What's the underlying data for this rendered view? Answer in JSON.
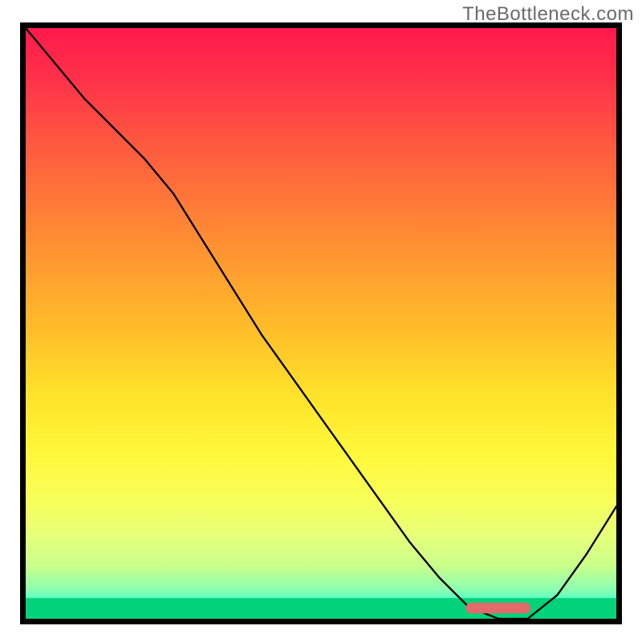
{
  "watermark": "TheBottleneck.com",
  "chart_data": {
    "type": "line",
    "title": "",
    "xlabel": "",
    "ylabel": "",
    "xlim": [
      0,
      1
    ],
    "ylim": [
      0,
      1
    ],
    "x": [
      0.0,
      0.05,
      0.1,
      0.15,
      0.2,
      0.25,
      0.3,
      0.35,
      0.4,
      0.45,
      0.5,
      0.55,
      0.6,
      0.65,
      0.7,
      0.75,
      0.8,
      0.85,
      0.9,
      0.95,
      1.0
    ],
    "y": [
      1.0,
      0.94,
      0.88,
      0.83,
      0.78,
      0.72,
      0.64,
      0.56,
      0.48,
      0.41,
      0.34,
      0.27,
      0.2,
      0.13,
      0.07,
      0.02,
      0.0,
      0.0,
      0.04,
      0.11,
      0.19
    ],
    "flat_segment": {
      "x0": 0.745,
      "x1": 0.855,
      "y": 0.018
    },
    "gradient_stops": [
      {
        "offset": 0.0,
        "color": "#ff1a4b"
      },
      {
        "offset": 0.08,
        "color": "#ff2f4a"
      },
      {
        "offset": 0.2,
        "color": "#ff5a3f"
      },
      {
        "offset": 0.35,
        "color": "#ff8b33"
      },
      {
        "offset": 0.5,
        "color": "#ffba2a"
      },
      {
        "offset": 0.62,
        "color": "#ffe22a"
      },
      {
        "offset": 0.72,
        "color": "#fff83a"
      },
      {
        "offset": 0.8,
        "color": "#f7ff5a"
      },
      {
        "offset": 0.86,
        "color": "#e6ff7a"
      },
      {
        "offset": 0.91,
        "color": "#c9ff8a"
      },
      {
        "offset": 0.95,
        "color": "#8dffb0"
      },
      {
        "offset": 0.975,
        "color": "#3effc8"
      },
      {
        "offset": 1.0,
        "color": "#00e07a"
      }
    ],
    "green_band": {
      "y0": 0.965,
      "y1": 1.0
    },
    "marker_color": "#e26a6a"
  }
}
